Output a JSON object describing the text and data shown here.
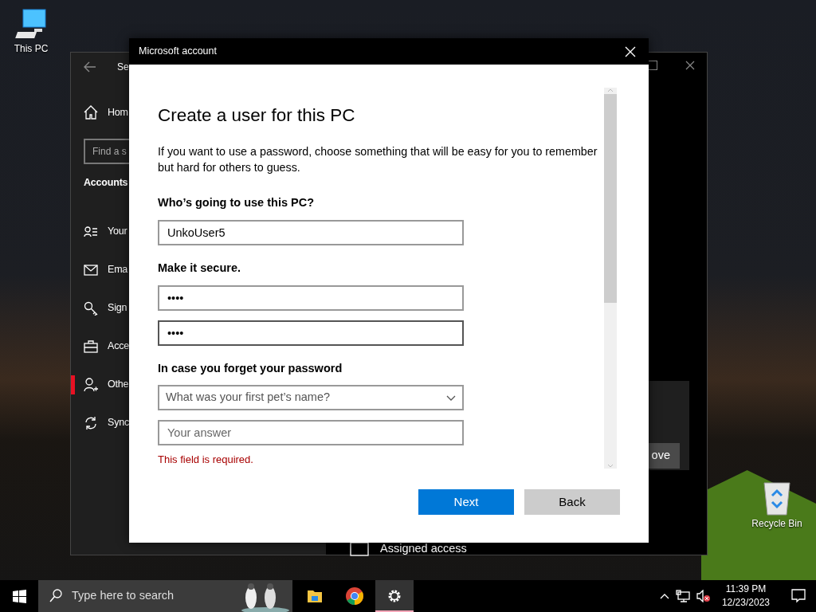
{
  "desktop_icons": [
    {
      "label": "This PC",
      "kind": "computer"
    },
    {
      "label": "Recycle Bin",
      "kind": "recycle"
    }
  ],
  "settings_window": {
    "title": "Se",
    "home": "Hom",
    "search": {
      "placeholder": "Find a s"
    },
    "section": "Accounts",
    "items": [
      {
        "label": "Your",
        "kind": "info",
        "selected": false
      },
      {
        "label": "Ema",
        "kind": "mail",
        "selected": false
      },
      {
        "label": "Sign",
        "kind": "key",
        "selected": false
      },
      {
        "label": "Acce",
        "kind": "briefcase",
        "selected": false
      },
      {
        "label": "Othe",
        "kind": "person-add",
        "selected": true
      },
      {
        "label": "Sync",
        "kind": "sync",
        "selected": false
      }
    ],
    "remove_button": "ove",
    "assigned_access": "Assigned access"
  },
  "dialog": {
    "title": "Microsoft account",
    "heading": "Create a user for this PC",
    "intro": "If you want to use a password, choose something that will be easy for you to remember but hard for others to guess.",
    "name_label": "Who’s going to use this PC?",
    "name_value": "UnkoUser5",
    "secure_label": "Make it secure.",
    "password": "••••",
    "confirm_password": "••••",
    "forgot_label": "In case you forget your password",
    "question": {
      "placeholder": "What was your first pet’s name?"
    },
    "answer": {
      "placeholder": "Your answer"
    },
    "error": "This field is required.",
    "buttons": [
      {
        "label": "Next",
        "kind": "primary"
      },
      {
        "label": "Back",
        "kind": "secondary"
      }
    ]
  },
  "taskbar": {
    "search": {
      "placeholder": "Type here to search"
    },
    "apps": [
      {
        "kind": "folder",
        "selected": false
      },
      {
        "kind": "browser",
        "selected": false
      },
      {
        "kind": "settings",
        "selected": true
      }
    ],
    "time": "11:39 PM",
    "date": "12/23/2023",
    "volume_muted": true
  }
}
